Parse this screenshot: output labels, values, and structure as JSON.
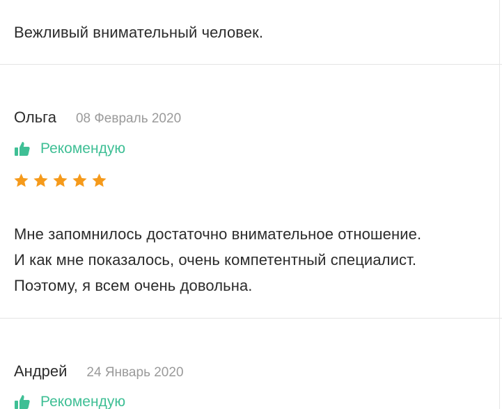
{
  "reviews": [
    {
      "text_lines": [
        "Вежливый внимательный человек."
      ]
    },
    {
      "name": "Ольга",
      "date": "08 Февраль 2020",
      "recommend_label": "Рекомендую",
      "rating": 5,
      "text_lines": [
        "Мне запомнилось достаточно внимательное отношение.",
        "И как мне показалось, очень компетентный специалист.",
        "Поэтому, я всем очень довольна."
      ]
    },
    {
      "name": "Андрей",
      "date": "24 Январь 2020",
      "recommend_label": "Рекомендую"
    }
  ],
  "icons": {
    "thumb": "thumbs-up-icon",
    "star": "star-icon"
  },
  "colors": {
    "accent_green": "#3fbf95",
    "star_orange": "#f59a1b",
    "date_gray": "#9a9a9a",
    "text": "#2b2b2b",
    "divider": "#e4e4e4"
  }
}
